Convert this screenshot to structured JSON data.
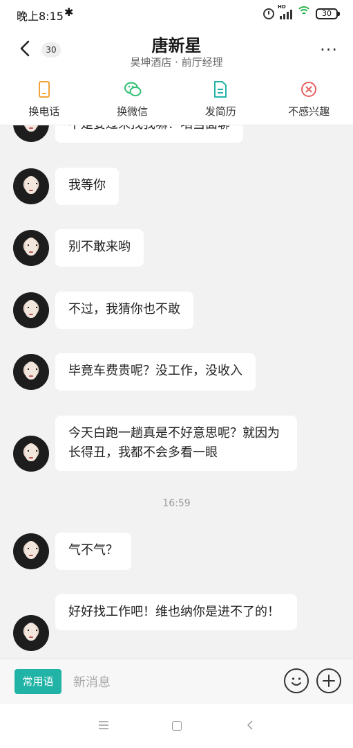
{
  "status_bar": {
    "time": "晚上8:15",
    "bluetooth": "bluetooth-icon",
    "battery": "30"
  },
  "header": {
    "unread_count": "30",
    "name": "唐新星",
    "subtitle": "昊坤酒店 · 前厅经理",
    "more": "···"
  },
  "actions": [
    {
      "label": "换电话",
      "icon": "phone-icon",
      "color": "#f2a23a"
    },
    {
      "label": "换微信",
      "icon": "wechat-icon",
      "color": "#2fbf72"
    },
    {
      "label": "发简历",
      "icon": "resume-icon",
      "color": "#23b3a6"
    },
    {
      "label": "不感兴趣",
      "icon": "not-interested-icon",
      "color": "#e75f5f"
    }
  ],
  "messages": [
    {
      "text": "不是要过来找我嘛？咱当面聊"
    },
    {
      "text": "我等你"
    },
    {
      "text": "别不敢来哟"
    },
    {
      "text": "不过，我猜你也不敢"
    },
    {
      "text": "毕竟车费贵呢？没工作，没收入"
    },
    {
      "text": "今天白跑一趟真是不好意思呢？就因为长得丑，我都不会多看一眼"
    },
    {
      "text": "气不气？"
    },
    {
      "text": "好好找工作吧！维也纳你是进不了的！"
    }
  ],
  "timestamp": "16:59",
  "input_bar": {
    "quick_phrase": "常用语",
    "placeholder": "新消息"
  }
}
